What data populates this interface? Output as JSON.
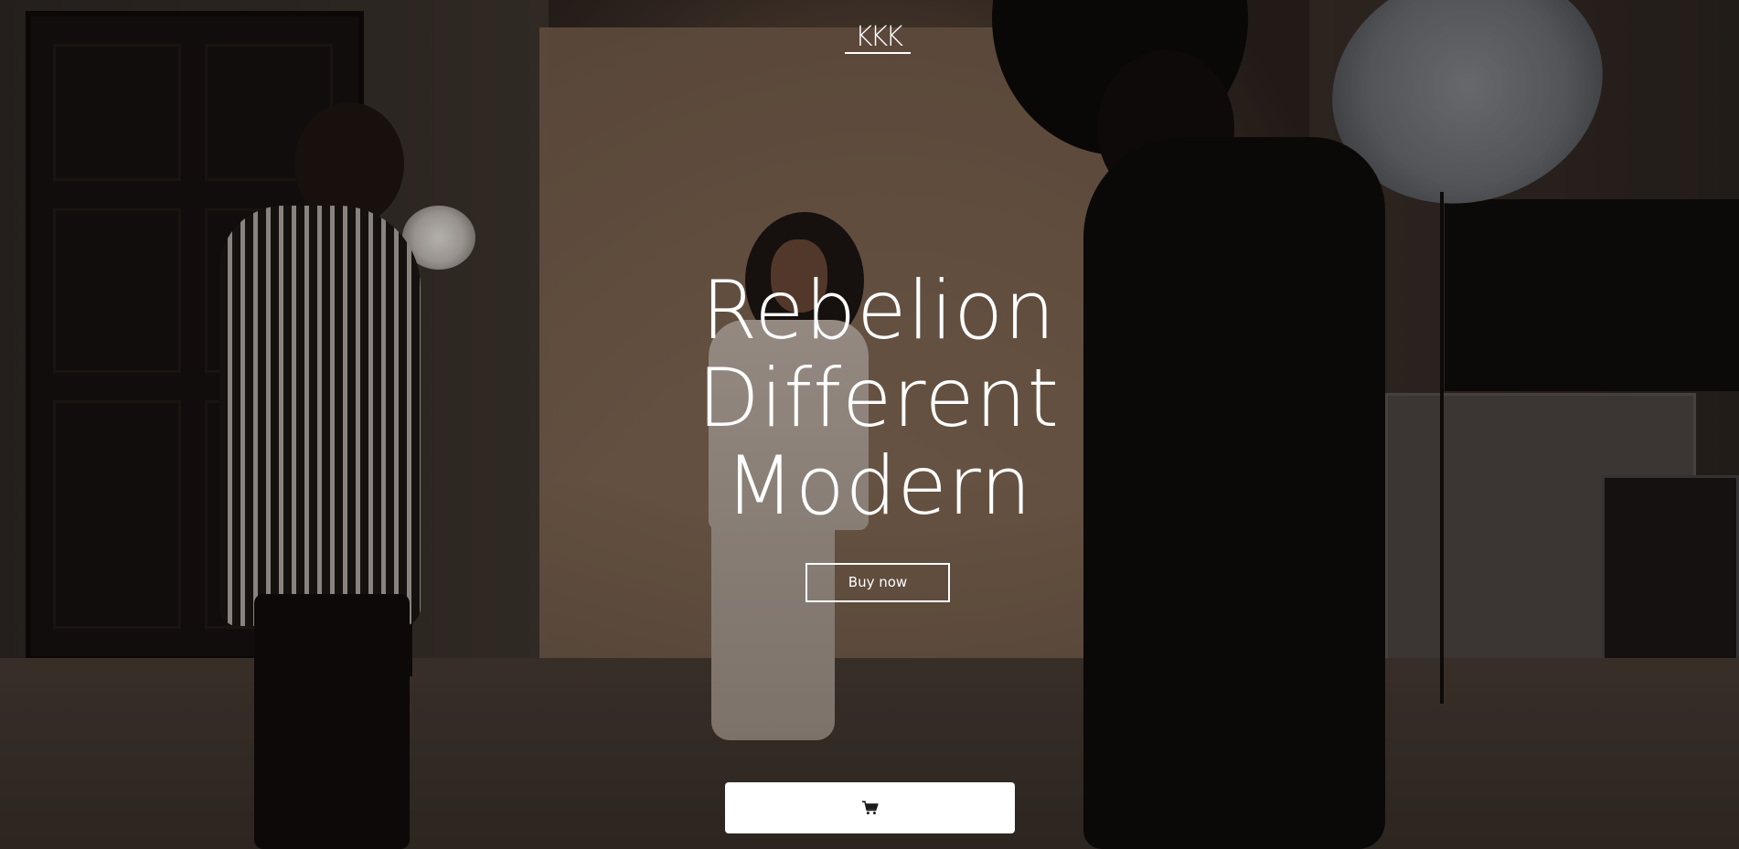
{
  "brand": {
    "logo_text": "KKK"
  },
  "hero": {
    "headline_lines": [
      "Rebelion",
      "Different",
      "Modern"
    ],
    "buy_button_label": "Buy now"
  },
  "cart_bar": {
    "icon": "shopping-cart-icon"
  },
  "colors": {
    "text": "#ffffff",
    "cart_bar_background": "#ffffff",
    "cart_icon": "#1a1a1a"
  }
}
